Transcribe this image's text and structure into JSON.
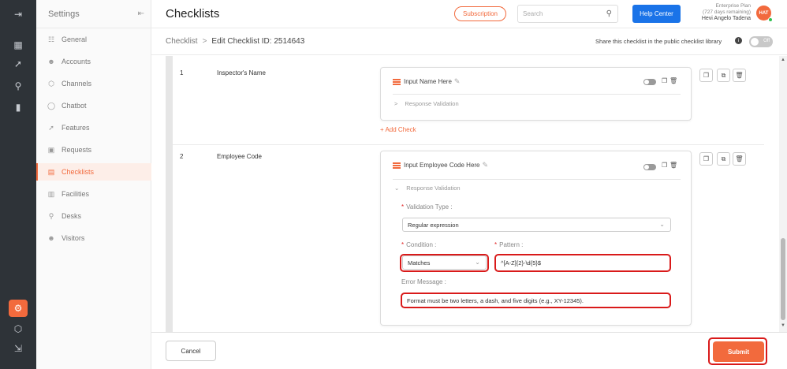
{
  "rail": {
    "items": [
      {
        "icon": "collapse-icon",
        "glyph": "⇥"
      },
      {
        "icon": "dashboard-icon",
        "glyph": "▦"
      },
      {
        "icon": "rocket-icon",
        "glyph": "➚"
      },
      {
        "icon": "hierarchy-icon",
        "glyph": "⚲"
      },
      {
        "icon": "analytics-icon",
        "glyph": "▮"
      },
      {
        "icon": "settings-icon",
        "glyph": "⚙"
      },
      {
        "icon": "cube-icon",
        "glyph": "⬡"
      },
      {
        "icon": "logout-icon",
        "glyph": "⇲"
      }
    ]
  },
  "sidebar": {
    "title": "Settings",
    "items": [
      {
        "label": "General",
        "glyph": "☷"
      },
      {
        "label": "Accounts",
        "glyph": "☻"
      },
      {
        "label": "Channels",
        "glyph": "⬡"
      },
      {
        "label": "Chatbot",
        "glyph": "◯"
      },
      {
        "label": "Features",
        "glyph": "➚"
      },
      {
        "label": "Requests",
        "glyph": "▣"
      },
      {
        "label": "Checklists",
        "glyph": "▤"
      },
      {
        "label": "Facilities",
        "glyph": "▥"
      },
      {
        "label": "Desks",
        "glyph": "⚲"
      },
      {
        "label": "Visitors",
        "glyph": "☻"
      }
    ],
    "active_index": 6
  },
  "header": {
    "title": "Checklists",
    "subscription_label": "Subscription",
    "search_placeholder": "Search",
    "help_label": "Help Center",
    "plan": "Enterprise Plan",
    "plan_days": "(727 days remaining)",
    "user_name": "Hevi Angelo Tadena",
    "avatar_initials": "HAT"
  },
  "subheader": {
    "crumb_root": "Checklist",
    "crumb_sep": ">",
    "crumb_current": "Edit Checklist ID: 2514643",
    "share_text": "Share this checklist in the public checklist library",
    "toggle_label": "Off"
  },
  "rows": [
    {
      "number": "1",
      "name": "Inspector's Name",
      "question": "Input Name Here",
      "response_validation": "Response Validation",
      "add_check": "+ Add Check"
    },
    {
      "number": "2",
      "name": "Employee Code",
      "question": "Input Employee Code Here",
      "response_validation": "Response Validation",
      "validation_type_label": "Validation Type :",
      "validation_type_value": "Regular expression",
      "condition_label": "Condition :",
      "condition_value": "Matches",
      "pattern_label": "Pattern :",
      "pattern_value": "^[A-Z]{2}-\\d{5}$",
      "error_label": "Error Message :",
      "error_value": "Format must be two letters, a dash, and five digits (e.g., XY-12345)."
    }
  ],
  "footer": {
    "cancel_label": "Cancel",
    "submit_label": "Submit"
  },
  "colors": {
    "accent": "#f26a3d",
    "rail_bg": "#2e3338",
    "help_blue": "#1a73e8",
    "highlight_red": "#d91a1a"
  }
}
